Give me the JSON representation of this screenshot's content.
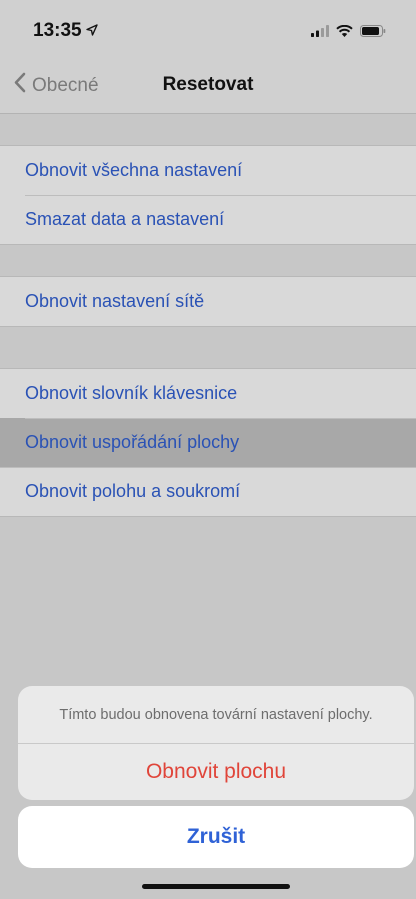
{
  "status_bar": {
    "time": "13:35",
    "location_icon": "location-arrow-icon",
    "signal_icon": "cellular-signal-icon",
    "wifi_icon": "wifi-icon",
    "battery_icon": "battery-icon"
  },
  "nav": {
    "back_label": "Obecné",
    "title": "Resetovat"
  },
  "groups": [
    {
      "items": [
        {
          "label": "Obnovit všechna nastavení"
        },
        {
          "label": "Smazat data a nastavení"
        }
      ]
    },
    {
      "items": [
        {
          "label": "Obnovit nastavení sítě"
        }
      ]
    },
    {
      "items": [
        {
          "label": "Obnovit slovník klávesnice"
        },
        {
          "label": "Obnovit uspořádání plochy",
          "highlighted": true
        },
        {
          "label": "Obnovit polohu a soukromí"
        }
      ]
    }
  ],
  "action_sheet": {
    "message": "Tímto budou obnovena tovární nastavení plochy.",
    "action_label": "Obnovit plochu",
    "cancel_label": "Zrušit"
  },
  "colors": {
    "link_blue": "#2a52b5",
    "destructive_red": "#e0453a",
    "cancel_blue": "#2f62d6"
  }
}
